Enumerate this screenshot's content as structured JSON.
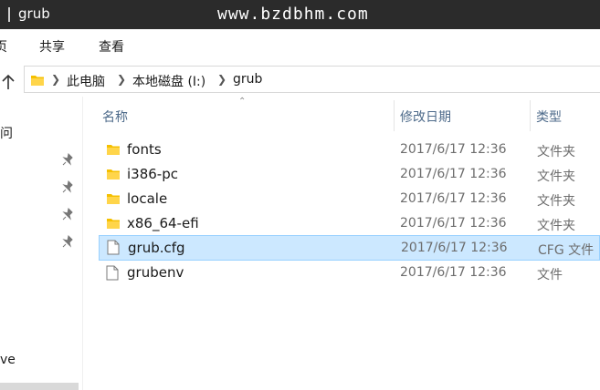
{
  "window": {
    "title": "grub",
    "watermark": "www.bzdbhm.com"
  },
  "ribbon": {
    "tabs": [
      "页",
      "共享",
      "查看"
    ]
  },
  "address": {
    "crumbs": [
      "此电脑",
      "本地磁盘 (I:)",
      "grub"
    ]
  },
  "navpane": {
    "labels": [
      "问",
      "ve"
    ]
  },
  "columns": {
    "name": "名称",
    "modified": "修改日期",
    "type": "类型"
  },
  "files": [
    {
      "name": "fonts",
      "modified": "2017/6/17 12:36",
      "type": "文件夹",
      "icon": "folder-icon"
    },
    {
      "name": "i386-pc",
      "modified": "2017/6/17 12:36",
      "type": "文件夹",
      "icon": "folder-icon"
    },
    {
      "name": "locale",
      "modified": "2017/6/17 12:36",
      "type": "文件夹",
      "icon": "folder-icon"
    },
    {
      "name": "x86_64-efi",
      "modified": "2017/6/17 12:36",
      "type": "文件夹",
      "icon": "folder-icon"
    },
    {
      "name": "grub.cfg",
      "modified": "2017/6/17 12:36",
      "type": "CFG 文件",
      "icon": "file-icon",
      "selected": true
    },
    {
      "name": "grubenv",
      "modified": "2017/6/17 12:36",
      "type": "文件",
      "icon": "file-icon"
    }
  ],
  "colors": {
    "selection": "#cce8ff",
    "selection_border": "#99d1ff",
    "folder": "#f5c000",
    "titlebar": "#2b2b2b"
  }
}
